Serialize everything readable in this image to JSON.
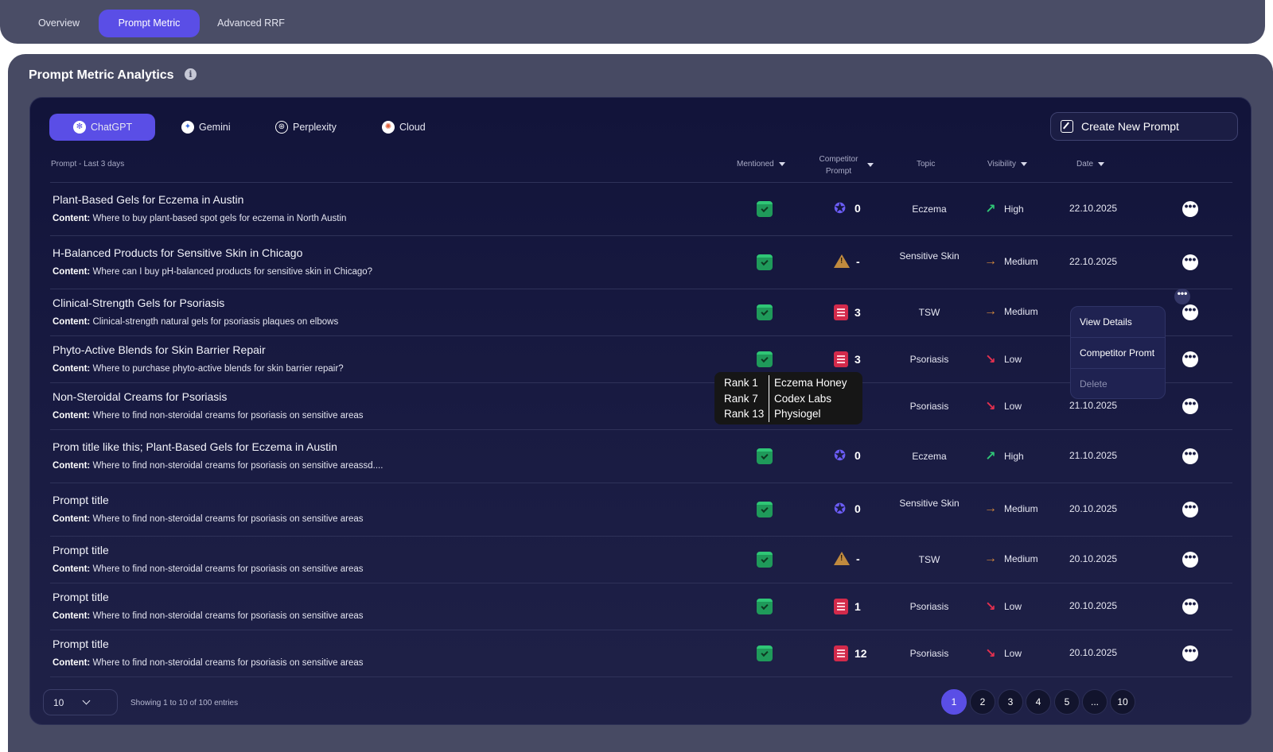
{
  "top_tabs": [
    {
      "label": "Overview"
    },
    {
      "label": "Prompt Metric"
    },
    {
      "label": "Advanced RRF"
    }
  ],
  "panel": {
    "title": "Prompt Metric Analytics",
    "info": "i"
  },
  "llm_tabs": [
    {
      "label": "ChatGPT"
    },
    {
      "label": "Gemini"
    },
    {
      "label": "Perplexity"
    },
    {
      "label": "Cloud"
    }
  ],
  "create_button": "Create New Prompt",
  "headers": {
    "prompt": "Prompt - Last 3 days",
    "mentioned": "Mentioned",
    "competitor_line1": "Competitor",
    "competitor_line2": "Prompt",
    "topic": "Topic",
    "visibility": "Visibility",
    "date": "Date"
  },
  "rows": [
    {
      "title": "Plant-Based Gels for Eczema in Austin",
      "content_label": "Content:",
      "content": "Where to buy plant-based spot gels for eczema in North Austin",
      "comp_icon": "star-icon",
      "comp_value": "0",
      "topic": "Eczema",
      "visibility": "High",
      "vis_arrow": "↗",
      "date": "22.10.2025"
    },
    {
      "title": "H-Balanced Products for Sensitive Skin in Chicago",
      "content_label": "Content:",
      "content": "Where can I buy pH-balanced products for sensitive skin in Chicago?",
      "comp_icon": "warning-icon",
      "comp_value": "-",
      "topic": "Sensitive Skin",
      "visibility": "Medium",
      "vis_arrow": "→",
      "date": "22.10.2025"
    },
    {
      "title": "Clinical-Strength Gels for Psoriasis",
      "content_label": "Content:",
      "content": "Clinical-strength natural gels for psoriasis plaques on elbows",
      "comp_icon": "document-icon",
      "comp_value": "3",
      "topic": "TSW",
      "visibility": "Medium",
      "vis_arrow": "→",
      "date": ""
    },
    {
      "title": "Phyto-Active Blends for Skin Barrier Repair",
      "content_label": "Content:",
      "content": "Where to purchase phyto-active blends for skin barrier repair?",
      "comp_icon": "document-icon",
      "comp_value": "3",
      "topic": "Psoriasis",
      "visibility": "Low",
      "vis_arrow": "↘",
      "date": ""
    },
    {
      "title": "Non-Steroidal Creams for Psoriasis",
      "content_label": "Content:",
      "content": "Where to find non-steroidal creams for psoriasis on sensitive areas",
      "comp_icon": "",
      "comp_value": "",
      "topic": "Psoriasis",
      "visibility": "Low",
      "vis_arrow": "↘",
      "date": "21.10.2025"
    },
    {
      "title": "Prom title like this; Plant-Based Gels for Eczema in Austin",
      "content_label": "Content:",
      "content": "Where to find non-steroidal creams for psoriasis on sensitive areassd....",
      "comp_icon": "star-icon",
      "comp_value": "0",
      "topic": "Eczema",
      "visibility": "High",
      "vis_arrow": "↗",
      "date": "21.10.2025"
    },
    {
      "title": "Prompt title",
      "content_label": "Content:",
      "content": "Where to find non-steroidal creams for psoriasis on sensitive areas",
      "comp_icon": "star-icon",
      "comp_value": "0",
      "topic": "Sensitive Skin",
      "visibility": "Medium",
      "vis_arrow": "→",
      "date": "20.10.2025"
    },
    {
      "title": "Prompt title",
      "content_label": "Content:",
      "content": "Where to find non-steroidal creams for psoriasis on sensitive areas",
      "comp_icon": "warning-icon",
      "comp_value": "-",
      "topic": "TSW",
      "visibility": "Medium",
      "vis_arrow": "→",
      "date": "20.10.2025"
    },
    {
      "title": "Prompt title",
      "content_label": "Content:",
      "content": "Where to find non-steroidal creams for psoriasis on sensitive areas",
      "comp_icon": "document-icon",
      "comp_value": "1",
      "topic": "Psoriasis",
      "visibility": "Low",
      "vis_arrow": "↘",
      "date": "20.10.2025"
    },
    {
      "title": "Prompt title",
      "content_label": "Content:",
      "content": "Where to find non-steroidal creams for psoriasis on sensitive areas",
      "comp_icon": "document-icon",
      "comp_value": "12",
      "topic": "Psoriasis",
      "visibility": "Low",
      "vis_arrow": "↘",
      "date": "20.10.2025"
    }
  ],
  "tooltip": [
    {
      "rank": "Rank 1",
      "name": "Eczema Honey"
    },
    {
      "rank": "Rank 7",
      "name": "Codex Labs"
    },
    {
      "rank": "Rank 13",
      "name": "Physiogel"
    }
  ],
  "menu": [
    "View Details",
    "Competitor Promt",
    "Delete"
  ],
  "footer": {
    "per_page": "10",
    "showing": "Showing 1 to 10 of 100 entries",
    "pages": [
      "1",
      "2",
      "3",
      "4",
      "5",
      "...",
      "10"
    ]
  },
  "colors": {
    "accent": "#5a4ee6",
    "high": "#2fc676",
    "medium": "#d68a3c",
    "low": "#e3304f"
  }
}
